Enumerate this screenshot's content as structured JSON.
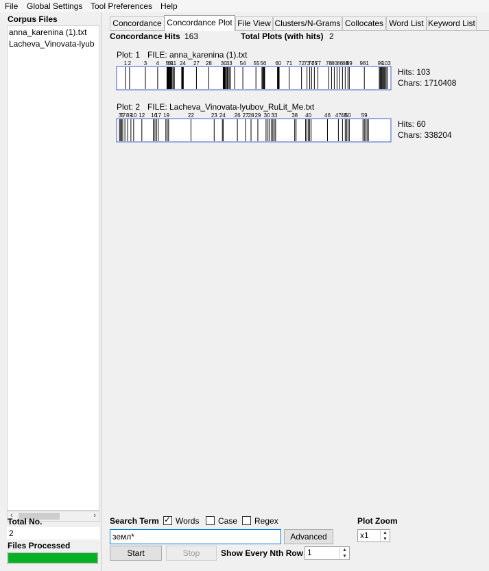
{
  "menu": [
    "File",
    "Global Settings",
    "Tool Preferences",
    "Help"
  ],
  "left": {
    "corpus_title": "Corpus Files",
    "files": [
      "anna_karenina (1).txt",
      "Lacheva_Vinovata-lyub"
    ],
    "total_no_label": "Total No.",
    "total_no_value": "2",
    "files_processed_label": "Files Processed",
    "progress": 1.0,
    "progress_color": "#06b025"
  },
  "tabs": [
    "Concordance",
    "Concordance Plot",
    "File View",
    "Clusters/N-Grams",
    "Collocates",
    "Word List",
    "Keyword List"
  ],
  "active_tab": "Concordance Plot",
  "summary": {
    "hits_label": "Concordance Hits",
    "hits_value": "163",
    "plots_label": "Total Plots (with hits)",
    "plots_value": "2"
  },
  "plots": [
    {
      "plot_label": "Plot: 1",
      "file_label": "FILE: anna_karenina (1).txt",
      "hits_text": "Hits: 103",
      "chars_text": "Chars: 1710408",
      "labels": [
        {
          "text": "1",
          "pos": 0.03
        },
        {
          "text": "2",
          "pos": 0.045
        },
        {
          "text": "3",
          "pos": 0.103
        },
        {
          "text": "4",
          "pos": 0.148
        },
        {
          "text": "5",
          "pos": 0.183
        },
        {
          "text": "6",
          "pos": 0.19
        },
        {
          "text": "9",
          "pos": 0.198
        },
        {
          "text": "11",
          "pos": 0.206
        },
        {
          "text": "24",
          "pos": 0.24
        },
        {
          "text": "27",
          "pos": 0.29
        },
        {
          "text": "28",
          "pos": 0.335
        },
        {
          "text": "30",
          "pos": 0.39
        },
        {
          "text": "33",
          "pos": 0.41
        },
        {
          "text": "54",
          "pos": 0.46
        },
        {
          "text": "55",
          "pos": 0.51
        },
        {
          "text": "56",
          "pos": 0.535
        },
        {
          "text": "60",
          "pos": 0.59
        },
        {
          "text": "71",
          "pos": 0.63
        },
        {
          "text": "72",
          "pos": 0.675
        },
        {
          "text": "73",
          "pos": 0.695
        },
        {
          "text": "74",
          "pos": 0.71
        },
        {
          "text": "75",
          "pos": 0.722
        },
        {
          "text": "77",
          "pos": 0.735
        },
        {
          "text": "78",
          "pos": 0.775
        },
        {
          "text": "80",
          "pos": 0.795
        },
        {
          "text": "86",
          "pos": 0.815
        },
        {
          "text": "88",
          "pos": 0.835
        },
        {
          "text": "89",
          "pos": 0.85
        },
        {
          "text": "981",
          "pos": 0.905
        },
        {
          "text": "99",
          "pos": 0.965
        },
        {
          "text": "103",
          "pos": 0.985
        }
      ],
      "marks": [
        0.03,
        0.045,
        0.103,
        0.148,
        0.182,
        0.184,
        0.186,
        0.188,
        0.19,
        0.192,
        0.194,
        0.196,
        0.198,
        0.201,
        0.205,
        0.209,
        0.236,
        0.238,
        0.24,
        0.242,
        0.29,
        0.335,
        0.388,
        0.39,
        0.392,
        0.394,
        0.396,
        0.4,
        0.403,
        0.406,
        0.41,
        0.415,
        0.43,
        0.46,
        0.508,
        0.53,
        0.533,
        0.536,
        0.538,
        0.54,
        0.587,
        0.589,
        0.591,
        0.593,
        0.63,
        0.675,
        0.695,
        0.705,
        0.712,
        0.722,
        0.735,
        0.775,
        0.785,
        0.795,
        0.805,
        0.815,
        0.825,
        0.835,
        0.845,
        0.85,
        0.905,
        0.96,
        0.963,
        0.966,
        0.969,
        0.972,
        0.975,
        0.978,
        0.981,
        0.985,
        0.99
      ]
    },
    {
      "plot_label": "Plot: 2",
      "file_label": "FILE: Lacheva_Vinovata-lyubov_RuLit_Me.txt",
      "hits_text": "Hits: 60",
      "chars_text": "Chars: 338204",
      "labels": [
        {
          "text": "3",
          "pos": 0.01
        },
        {
          "text": "5",
          "pos": 0.018
        },
        {
          "text": "7",
          "pos": 0.025
        },
        {
          "text": "8",
          "pos": 0.038
        },
        {
          "text": "9",
          "pos": 0.05
        },
        {
          "text": "10",
          "pos": 0.06
        },
        {
          "text": "12",
          "pos": 0.09
        },
        {
          "text": "16",
          "pos": 0.135
        },
        {
          "text": "17",
          "pos": 0.15
        },
        {
          "text": "19",
          "pos": 0.18
        },
        {
          "text": "22",
          "pos": 0.27
        },
        {
          "text": "23",
          "pos": 0.355
        },
        {
          "text": "24",
          "pos": 0.385
        },
        {
          "text": "26",
          "pos": 0.44
        },
        {
          "text": "27",
          "pos": 0.47
        },
        {
          "text": "28",
          "pos": 0.49
        },
        {
          "text": "29",
          "pos": 0.515
        },
        {
          "text": "30",
          "pos": 0.548
        },
        {
          "text": "33",
          "pos": 0.575
        },
        {
          "text": "38",
          "pos": 0.65
        },
        {
          "text": "40",
          "pos": 0.7
        },
        {
          "text": "46",
          "pos": 0.77
        },
        {
          "text": "47",
          "pos": 0.81
        },
        {
          "text": "48",
          "pos": 0.83
        },
        {
          "text": "50",
          "pos": 0.845
        },
        {
          "text": "59",
          "pos": 0.905
        }
      ],
      "marks": [
        0.008,
        0.012,
        0.016,
        0.02,
        0.028,
        0.038,
        0.05,
        0.06,
        0.09,
        0.132,
        0.138,
        0.144,
        0.15,
        0.178,
        0.183,
        0.188,
        0.27,
        0.355,
        0.385,
        0.388,
        0.44,
        0.47,
        0.49,
        0.515,
        0.545,
        0.552,
        0.558,
        0.565,
        0.57,
        0.575,
        0.58,
        0.65,
        0.655,
        0.69,
        0.695,
        0.7,
        0.705,
        0.71,
        0.77,
        0.81,
        0.825,
        0.835,
        0.84,
        0.845,
        0.85,
        0.9,
        0.905,
        0.91,
        0.915,
        0.92
      ]
    }
  ],
  "controls": {
    "search_term_label": "Search Term",
    "words_label": "Words",
    "words_checked": true,
    "case_label": "Case",
    "case_checked": false,
    "regex_label": "Regex",
    "regex_checked": false,
    "search_value": "земл*",
    "advanced_label": "Advanced",
    "start_label": "Start",
    "stop_label": "Stop",
    "nth_row_label": "Show Every Nth Row",
    "nth_row_value": "1",
    "zoom_label": "Plot Zoom",
    "zoom_value": "x1"
  }
}
